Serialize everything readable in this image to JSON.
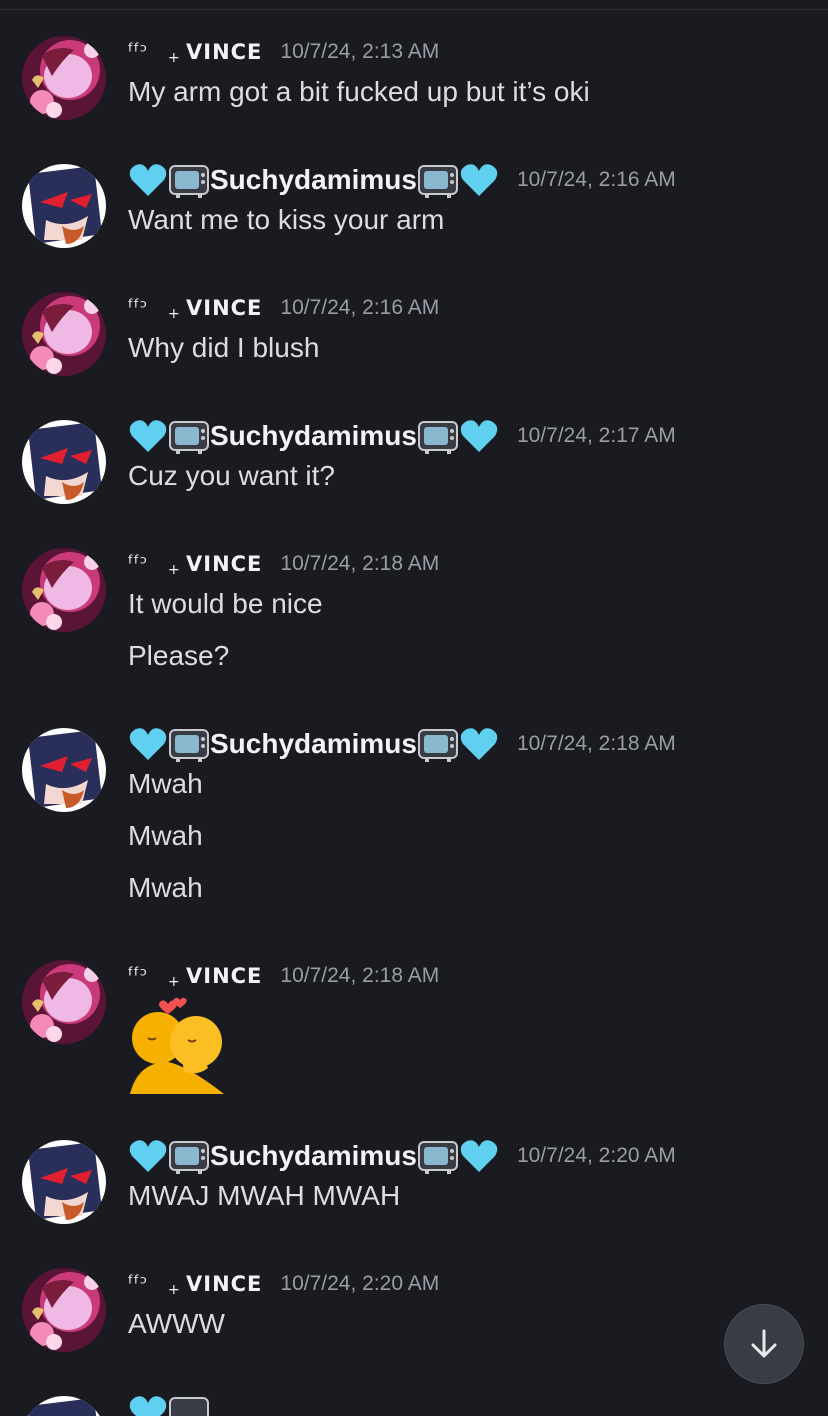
{
  "messages": [
    {
      "author": "ꜰ ᵎᴼ⁺ VINCE",
      "name": "VINCE",
      "timestamp": "10/7/24, 2:13 AM",
      "lines": [
        "My arm got a bit fucked up but it’s oki"
      ]
    },
    {
      "author": "Suchydamimus",
      "name": "Suchydamimus",
      "timestamp": "10/7/24, 2:16 AM",
      "lines": [
        "Want me to kiss your arm"
      ]
    },
    {
      "author": "VINCE",
      "name": "VINCE",
      "timestamp": "10/7/24, 2:16 AM",
      "lines": [
        "Why did I blush"
      ]
    },
    {
      "author": "Suchydamimus",
      "name": "Suchydamimus",
      "timestamp": "10/7/24, 2:17 AM",
      "lines": [
        "Cuz you want it?"
      ]
    },
    {
      "author": "VINCE",
      "name": "VINCE",
      "timestamp": "10/7/24, 2:18 AM",
      "lines": [
        "It would be nice",
        "Please?"
      ]
    },
    {
      "author": "Suchydamimus",
      "name": "Suchydamimus",
      "timestamp": "10/7/24, 2:18 AM",
      "lines": [
        "Mwah",
        "Mwah",
        "Mwah"
      ]
    },
    {
      "author": "VINCE",
      "name": "VINCE",
      "timestamp": "10/7/24, 2:18 AM",
      "sticker": "hugging-kiss-emoji"
    },
    {
      "author": "Suchydamimus",
      "name": "Suchydamimus",
      "timestamp": "10/7/24, 2:20 AM",
      "lines": [
        "MWAJ MWAH MWAH"
      ]
    },
    {
      "author": "VINCE",
      "name": "VINCE",
      "timestamp": "10/7/24, 2:20 AM",
      "lines": [
        "AWWW"
      ]
    }
  ],
  "colors": {
    "background": "#1a1b20",
    "text": "#dcdde1",
    "username": "#f2f3f5",
    "timestamp": "#9a9ca4",
    "heart": "#5fd0f0"
  },
  "icons": {
    "scroll_button": "arrow-down-icon",
    "vince_prefix": "kaomoji-glyph",
    "such_decorations": [
      "light-blue-heart-icon",
      "television-icon"
    ]
  }
}
